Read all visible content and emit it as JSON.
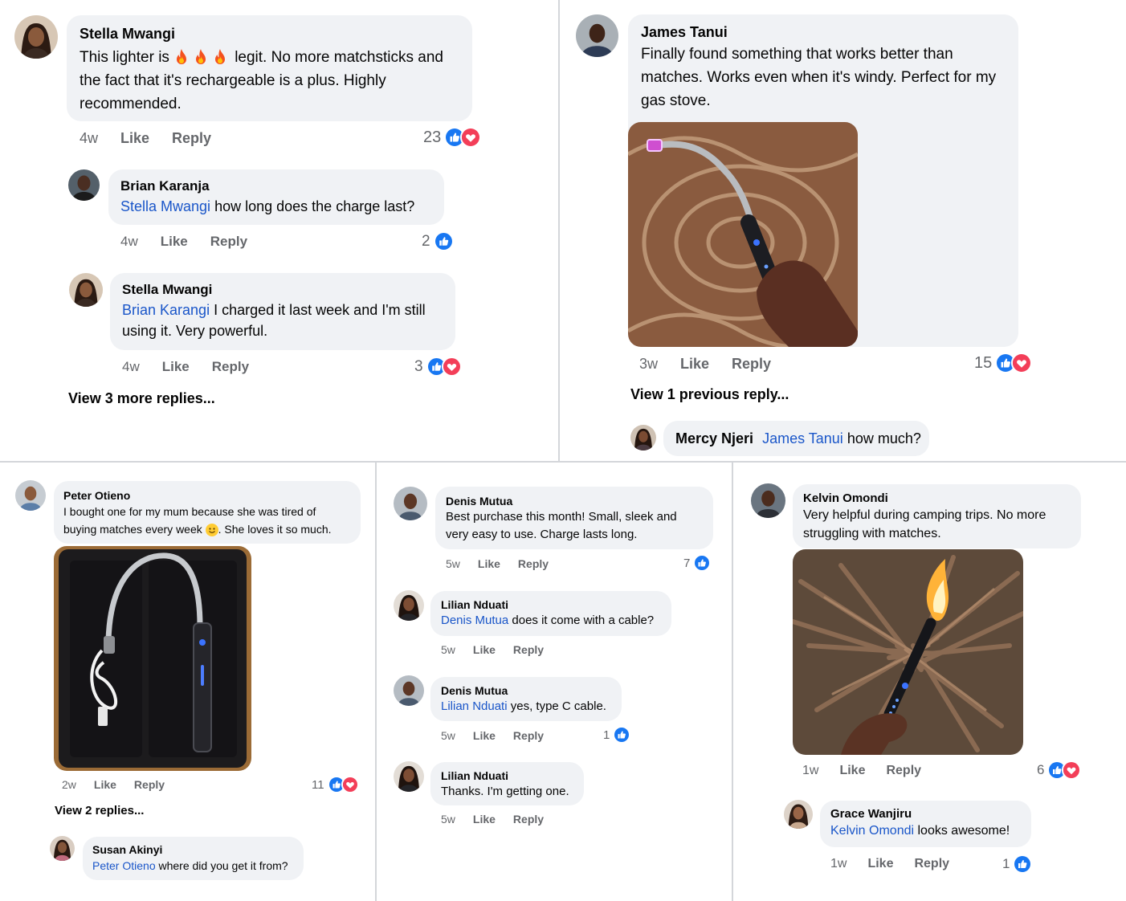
{
  "colors": {
    "like": "#1877f2",
    "love": "#f33e58",
    "bubble": "#f0f2f5",
    "mention": "#1a56c9",
    "meta": "#65676b"
  },
  "actions": {
    "like": "Like",
    "reply": "Reply"
  },
  "panel1": {
    "c1": {
      "name": "Stella Mwangi",
      "text_a": "This lighter is",
      "text_b": "legit. No more matchsticks and the fact that it's rechargeable is a plus. Highly recommended.",
      "emoji": "fire x3",
      "time": "4w",
      "count": "23",
      "reactions": [
        "like-icon",
        "love-icon"
      ]
    },
    "r1": {
      "name": "Brian Karanja",
      "mention": "Stella Mwangi",
      "text": "how long does the charge last?",
      "time": "4w",
      "count": "2",
      "reactions": [
        "like-icon"
      ]
    },
    "r2": {
      "name": "Stella Mwangi",
      "mention": "Brian Karangi",
      "text": "I charged it last week and I'm still using it. Very powerful.",
      "time": "4w",
      "count": "3",
      "reactions": [
        "like-icon",
        "love-icon"
      ]
    },
    "more": "View 3 more replies..."
  },
  "panel2": {
    "c1": {
      "name": "James Tanui",
      "text": "Finally found something that works better than matches. Works even when it's windy. Perfect for my gas stove.",
      "image": "lighter-on-rug-photo",
      "time": "3w",
      "count": "15",
      "reactions": [
        "like-icon",
        "love-icon"
      ]
    },
    "more": "View 1 previous reply...",
    "r1": {
      "name": "Mercy Njeri",
      "mention": "James Tanui",
      "text": "how much?"
    }
  },
  "panel3": {
    "c1": {
      "name": "Peter Otieno",
      "text_a": "I bought one for my mum because she was tired of buying matches every week",
      "emoji": "smile",
      "text_b": ". She loves it so much.",
      "image": "lighter-in-box-photo",
      "time": "2w",
      "count": "11",
      "reactions": [
        "like-icon",
        "love-icon"
      ]
    },
    "more": "View 2 replies...",
    "r1": {
      "name": "Susan Akinyi",
      "mention": "Peter Otieno",
      "text": "where did you get it from?"
    }
  },
  "panel4": {
    "c1": {
      "name": "Denis Mutua",
      "text": "Best purchase this month! Small, sleek and very easy to use. Charge lasts long.",
      "time": "5w",
      "count": "7",
      "reactions": [
        "like-icon"
      ]
    },
    "r1": {
      "name": "Lilian Nduati",
      "mention": "Denis Mutua",
      "text": "does it come with a cable?",
      "time": "5w"
    },
    "r2": {
      "name": "Denis Mutua",
      "mention": "Lilian Nduati",
      "text": "yes, type C cable.",
      "time": "5w",
      "count": "1",
      "reactions": [
        "like-icon"
      ]
    },
    "r3": {
      "name": "Lilian Nduati",
      "text": "Thanks. I'm getting one.",
      "time": "5w"
    }
  },
  "panel5": {
    "c1": {
      "name": "Kelvin Omondi",
      "text": "Very helpful during camping trips. No more struggling with matches.",
      "image": "lighter-lighting-firewood-photo",
      "time": "1w",
      "count": "6",
      "reactions": [
        "like-icon",
        "love-icon"
      ]
    },
    "r1": {
      "name": "Grace Wanjiru",
      "mention": "Kelvin Omondi",
      "text": "looks awesome!",
      "time": "1w",
      "count": "1",
      "reactions": [
        "like-icon"
      ]
    }
  }
}
